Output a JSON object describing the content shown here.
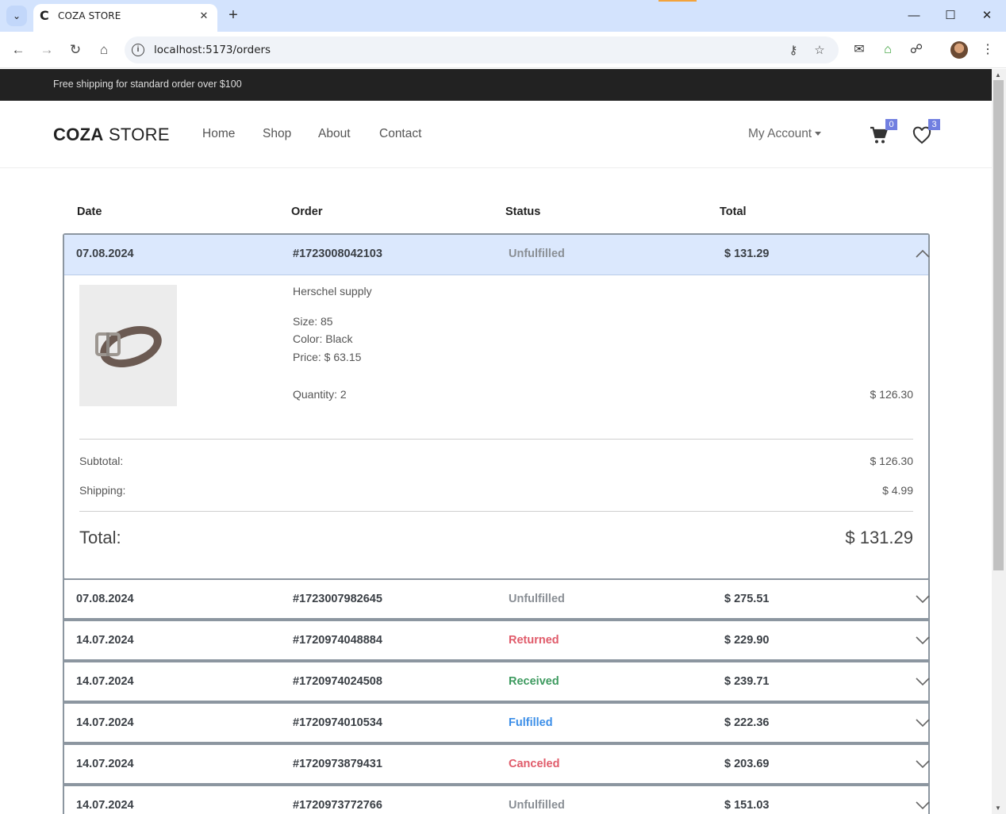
{
  "browser": {
    "tab_title": "COZA STORE",
    "url": "localhost:5173/orders",
    "colors": {
      "tabbar": "#d3e3fd",
      "accent_strip": "#f3a33b"
    }
  },
  "topbar": {
    "text": "Free shipping for standard order over $100"
  },
  "header": {
    "logo_bold": "COZA",
    "logo_light": " STORE",
    "menu": [
      "Home",
      "Shop",
      "About",
      "Contact"
    ],
    "account": "My Account",
    "cart_count": "0",
    "wishlist_count": "3",
    "badge_color": "#717fe0"
  },
  "table": {
    "headers": [
      "Date",
      "Order",
      "Status",
      "Total"
    ]
  },
  "expanded_order": {
    "date": "07.08.2024",
    "order": "#1723008042103",
    "status": "Unfulfilled",
    "total": "$ 131.29",
    "item": {
      "name": "Herschel supply",
      "size": "Size: 85",
      "color": "Color: Black",
      "price": "Price: $ 63.15",
      "quantity": "Quantity: 2",
      "line_total": "$ 126.30"
    },
    "subtotal_label": "Subtotal:",
    "subtotal": "$ 126.30",
    "shipping_label": "Shipping:",
    "shipping": "$ 4.99",
    "total_label": "Total:",
    "grand_total": "$ 131.29"
  },
  "orders": [
    {
      "date": "07.08.2024",
      "order": "#1723007982645",
      "status": "Unfulfilled",
      "status_color": "#8a8f95",
      "total": "$ 275.51"
    },
    {
      "date": "14.07.2024",
      "order": "#1720974048884",
      "status": "Returned",
      "status_color": "#e05b6a",
      "total": "$ 229.90"
    },
    {
      "date": "14.07.2024",
      "order": "#1720974024508",
      "status": "Received",
      "status_color": "#3d9a5f",
      "total": "$ 239.71"
    },
    {
      "date": "14.07.2024",
      "order": "#1720974010534",
      "status": "Fulfilled",
      "status_color": "#3b8ee8",
      "total": "$ 222.36"
    },
    {
      "date": "14.07.2024",
      "order": "#1720973879431",
      "status": "Canceled",
      "status_color": "#e05b6a",
      "total": "$ 203.69"
    },
    {
      "date": "14.07.2024",
      "order": "#1720973772766",
      "status": "Unfulfilled",
      "status_color": "#8a8f95",
      "total": "$ 151.03"
    }
  ]
}
